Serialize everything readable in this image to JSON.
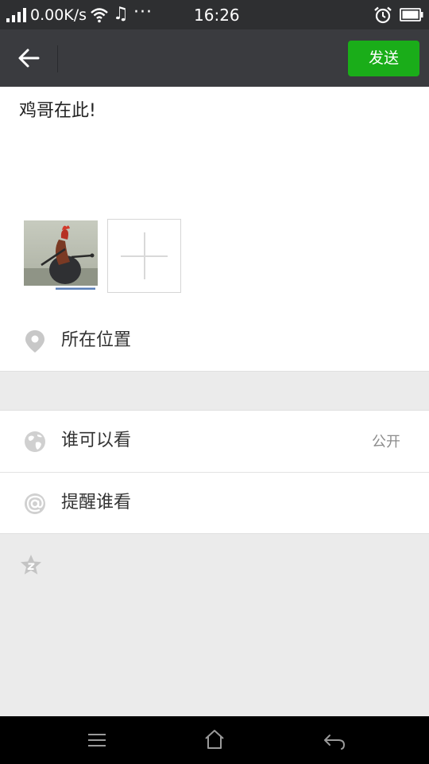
{
  "status_bar": {
    "network_speed": "0.00K/s",
    "time": "16:26",
    "more": "···",
    "icons": [
      "signal-icon",
      "wifi-icon",
      "music-icon",
      "alarm-icon",
      "battery-icon"
    ]
  },
  "header": {
    "send_label": "发送",
    "icons": [
      "back-arrow-icon"
    ]
  },
  "composer": {
    "text": "鸡哥在此!",
    "photos": [
      "rooster-photo"
    ],
    "add_photo_icon": "plus-icon"
  },
  "options": {
    "location_label": "所在位置",
    "visibility_label": "谁可以看",
    "visibility_value": "公开",
    "mention_label": "提醒谁看",
    "icons": [
      "location-pin-icon",
      "globe-icon",
      "at-icon",
      "star-icon"
    ]
  },
  "nav_bar": {
    "icons": [
      "menu-icon",
      "home-icon",
      "back-icon"
    ]
  },
  "colors": {
    "status_bar_bg": "#2e2f31",
    "title_bar_bg": "#3a3b3f",
    "accent_green": "#1aad19",
    "section_gray": "#ebebeb"
  }
}
